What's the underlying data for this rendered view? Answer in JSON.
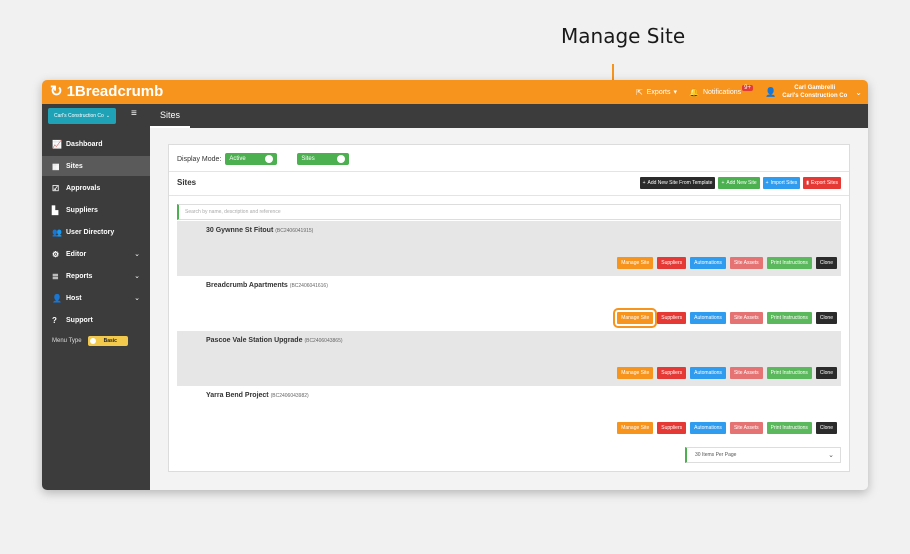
{
  "annotation": {
    "title": "Manage Site"
  },
  "topbar": {
    "brand": "1Breadcrumb",
    "logo_icon": "breadcrumb-logo",
    "exports_label": "Exports",
    "notifications_label": "Notifications",
    "notifications_count": "9+",
    "user_name": "Carl Gambrelli",
    "user_company": "Carl's Construction Co",
    "accent_color": "#f7941d"
  },
  "subbar": {
    "org_label": "Carl's Construction Co",
    "tab_label": "Sites"
  },
  "sidebar": {
    "items": [
      {
        "label": "Dashboard",
        "icon": "chart-line-icon"
      },
      {
        "label": "Sites",
        "icon": "building-icon"
      },
      {
        "label": "Approvals",
        "icon": "check-square-icon"
      },
      {
        "label": "Suppliers",
        "icon": "industry-icon"
      },
      {
        "label": "User Directory",
        "icon": "users-icon"
      },
      {
        "label": "Editor",
        "icon": "gear-icon"
      },
      {
        "label": "Reports",
        "icon": "list-icon"
      },
      {
        "label": "Host",
        "icon": "user-group-icon"
      },
      {
        "label": "Support",
        "icon": "question-icon"
      }
    ],
    "menu_type_label": "Menu Type",
    "menu_type_value": "Basic"
  },
  "main": {
    "display_mode_label": "Display Mode:",
    "active_toggle": "Active",
    "sites_toggle": "Sites",
    "heading": "Sites",
    "actions": {
      "new_from_template": "Add New Site From Template",
      "new_site": "Add New Site",
      "import": "Import Sites",
      "export": "Export Sites"
    },
    "search_placeholder": "Search by name, description and reference",
    "row_buttons": {
      "manage": "Manage Site",
      "suppliers": "Suppliers",
      "automations": "Automations",
      "assets": "Site Assets",
      "print": "Print Instructions",
      "clone": "Clone"
    },
    "sites": [
      {
        "name": "30 Gywnne St Fitout",
        "code": "(BC2406041915)"
      },
      {
        "name": "Breadcrumb Apartments",
        "code": "(BC2406041616)"
      },
      {
        "name": "Pascoe Vale Station Upgrade",
        "code": "(BC2406043865)"
      },
      {
        "name": "Yarra Bend Project",
        "code": "(BC2406043982)"
      }
    ],
    "pager_label": "30 Items Per Page"
  }
}
